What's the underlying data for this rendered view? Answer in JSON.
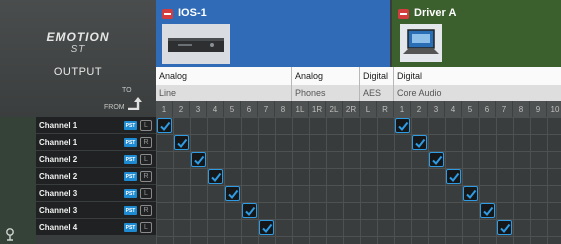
{
  "brand": {
    "logo_line1": "EMOTION",
    "logo_line2": "ST",
    "output_title": "OUTPUT",
    "to_label": "TO",
    "from_label": "FROM"
  },
  "devices": [
    {
      "name": "IOS-1",
      "color": "#2f6bb6",
      "icon": "interface-unit-icon"
    },
    {
      "name": "Driver A",
      "color": "#3b5f2d",
      "icon": "laptop-icon"
    }
  ],
  "type_row": [
    "Analog",
    "Analog",
    "Digital",
    "Digital"
  ],
  "sub_row": [
    "Line",
    "Phones",
    "AES",
    "Core Audio"
  ],
  "column_numbers": [
    "1",
    "2",
    "3",
    "4",
    "5",
    "6",
    "7",
    "8",
    "1L",
    "1R",
    "2L",
    "2R",
    "L",
    "R",
    "1",
    "2",
    "3",
    "4",
    "5",
    "6",
    "7",
    "8",
    "9",
    "10"
  ],
  "channels": [
    {
      "name": "Channel 1",
      "pst": "PST",
      "link": "L"
    },
    {
      "name": "Channel 1",
      "pst": "PST",
      "link": "R"
    },
    {
      "name": "Channel 2",
      "pst": "PST",
      "link": "L"
    },
    {
      "name": "Channel 2",
      "pst": "PST",
      "link": "R"
    },
    {
      "name": "Channel 3",
      "pst": "PST",
      "link": "L"
    },
    {
      "name": "Channel 3",
      "pst": "PST",
      "link": "R"
    },
    {
      "name": "Channel 4",
      "pst": "PST",
      "link": "L"
    }
  ],
  "routes_checked": [
    [
      0,
      0
    ],
    [
      0,
      14
    ],
    [
      1,
      1
    ],
    [
      1,
      15
    ],
    [
      2,
      2
    ],
    [
      2,
      16
    ],
    [
      3,
      3
    ],
    [
      3,
      17
    ],
    [
      4,
      4
    ],
    [
      4,
      18
    ],
    [
      5,
      5
    ],
    [
      5,
      19
    ],
    [
      6,
      6
    ],
    [
      6,
      20
    ]
  ],
  "colors": {
    "accent_blue": "#2f9be3",
    "pst_blue": "#1e8ad2",
    "badge_red": "#d33d3d"
  }
}
